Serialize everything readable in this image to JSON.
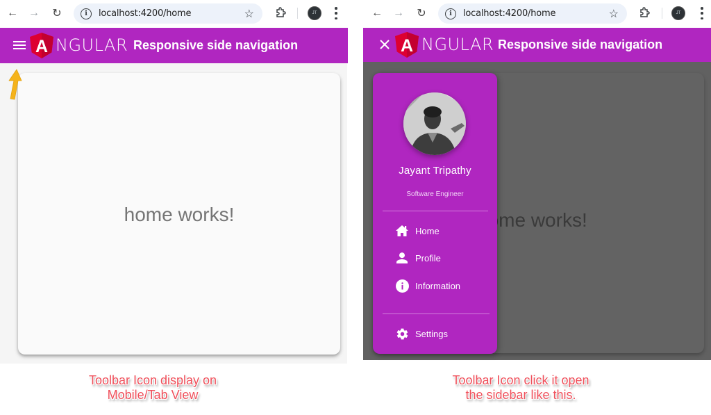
{
  "screens": {
    "left": {
      "browser": {
        "url": "localhost:4200/home",
        "profile_initials": "JT"
      },
      "toolbar": {
        "menu_icon": "hamburger-menu-icon",
        "logo_letter": "A",
        "logo_text": "NGULAR",
        "title": "Responsive side navigation"
      },
      "content": {
        "home_text": "home works!"
      },
      "annotation": {
        "arrow_icon": "up-arrow-icon",
        "caption_line1": "Toolbar Icon display on",
        "caption_line2": "Mobile/Tab View"
      }
    },
    "right": {
      "browser": {
        "url": "localhost:4200/home",
        "profile_initials": "JT"
      },
      "toolbar": {
        "menu_icon": "close-icon",
        "logo_letter": "A",
        "logo_text": "NGULAR",
        "title": "Responsive side navigation"
      },
      "content": {
        "home_text": "home works!"
      },
      "sidenav": {
        "user_name": "Jayant Tripathy",
        "user_role": "Software Engineer",
        "items": [
          {
            "label": "Home",
            "icon": "home-icon"
          },
          {
            "label": "Profile",
            "icon": "person-icon"
          },
          {
            "label": "Information",
            "icon": "info-icon"
          }
        ],
        "footer_item": {
          "label": "Settings",
          "icon": "gear-icon"
        }
      },
      "annotation": {
        "caption_line1": "Toolbar Icon click it open",
        "caption_line2": "the sidebar like this."
      }
    }
  },
  "colors": {
    "toolbar": "#b026c0",
    "angular_red": "#dd0031",
    "caption": "#ef4f5a",
    "arrow": "#f5b31b"
  }
}
